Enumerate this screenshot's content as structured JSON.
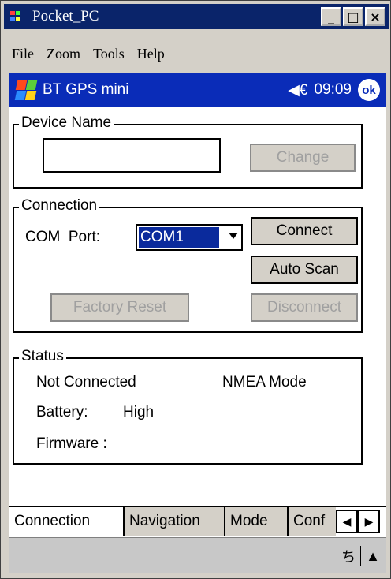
{
  "window": {
    "title": "Pocket_PC",
    "min_label": "_",
    "max_label": "□",
    "close_label": "×"
  },
  "menu": {
    "items": [
      "File",
      "Zoom",
      "Tools",
      "Help"
    ]
  },
  "nav": {
    "title": "BT GPS mini",
    "time": "09:09",
    "ok_label": "ok",
    "speaker": "◀€"
  },
  "device_name": {
    "title": "Device Name",
    "value": "",
    "change_label": "Change"
  },
  "connection": {
    "title": "Connection",
    "com_label": "COM  Port:",
    "com_value": "COM1",
    "connect_label": "Connect",
    "auto_scan_label": "Auto Scan",
    "factory_reset_label": "Factory Reset",
    "disconnect_label": "Disconnect"
  },
  "status": {
    "title": "Status",
    "connection_state": "Not Connected",
    "mode": "NMEA Mode",
    "battery_label": "Battery:",
    "battery_value": "High",
    "firmware_label": "Firmware :"
  },
  "tabs": [
    "Connection",
    "Navigation",
    "Mode",
    "Conf"
  ],
  "tab_arrows": {
    "left": "◀",
    "right": "▶"
  },
  "sip": {
    "keyboard": "ち",
    "up": "▲"
  },
  "colors": {
    "title_bar": "#0a246a",
    "nav_bar": "#0a2cb8",
    "selection": "#0a2a9c"
  }
}
